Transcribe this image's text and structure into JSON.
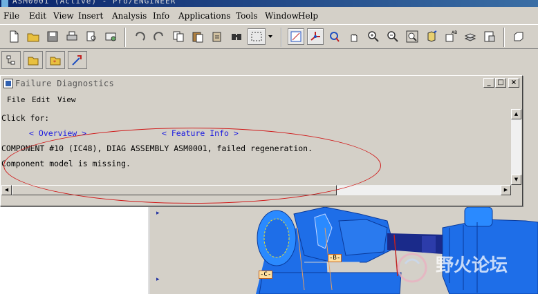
{
  "window": {
    "title": "ASM0001 (Active) - Pro/ENGINEER"
  },
  "menubar": {
    "items": [
      "File",
      "Edit",
      "View",
      "Insert",
      "Analysis",
      "Info",
      "Applications",
      "Tools",
      "Window",
      "Help"
    ]
  },
  "toolbar": {
    "buttons": [
      "new-file-icon",
      "open-folder-icon",
      "save-icon",
      "print-icon",
      "print-preview-icon",
      "email-icon",
      "undo-icon",
      "redo-icon",
      "copy-icon",
      "paste-icon",
      "paste-special-icon",
      "find-icon",
      "select-box-icon",
      "repaint-icon",
      "spin-center-icon",
      "orient-mode-icon",
      "pan-icon",
      "zoom-in-icon",
      "zoom-out-icon",
      "refit-icon",
      "reorient-icon",
      "saved-views-icon",
      "layers-icon",
      "model-tree-icon",
      "window-icon"
    ]
  },
  "left_panel": {
    "tabs": [
      "model-tree-tab",
      "folder-browser-tab",
      "favorites-tab",
      "connections-tab"
    ]
  },
  "dialog": {
    "title": "Failure Diagnostics",
    "menu": [
      "File",
      "Edit",
      "View"
    ],
    "click_for": "Click for:",
    "overview_link": "< Overview >",
    "feature_info_link": "< Feature Info >",
    "message_line1": "COMPONENT #10 (IC48), DIAG ASSEMBLY ASM0001, failed regeneration.",
    "message_line2": "Component model is missing.",
    "controls": {
      "minimize": "_",
      "maximize": "□",
      "close": "×"
    }
  },
  "model_labels": {
    "b": "-B-",
    "c": "-C-"
  },
  "colors": {
    "annotation_ellipse": "#d01818",
    "link": "#1a1ae0",
    "model_blue": "#1e6ee8",
    "shaft_navy": "#1a2a8a"
  },
  "watermark": {
    "text": "野火论坛"
  }
}
